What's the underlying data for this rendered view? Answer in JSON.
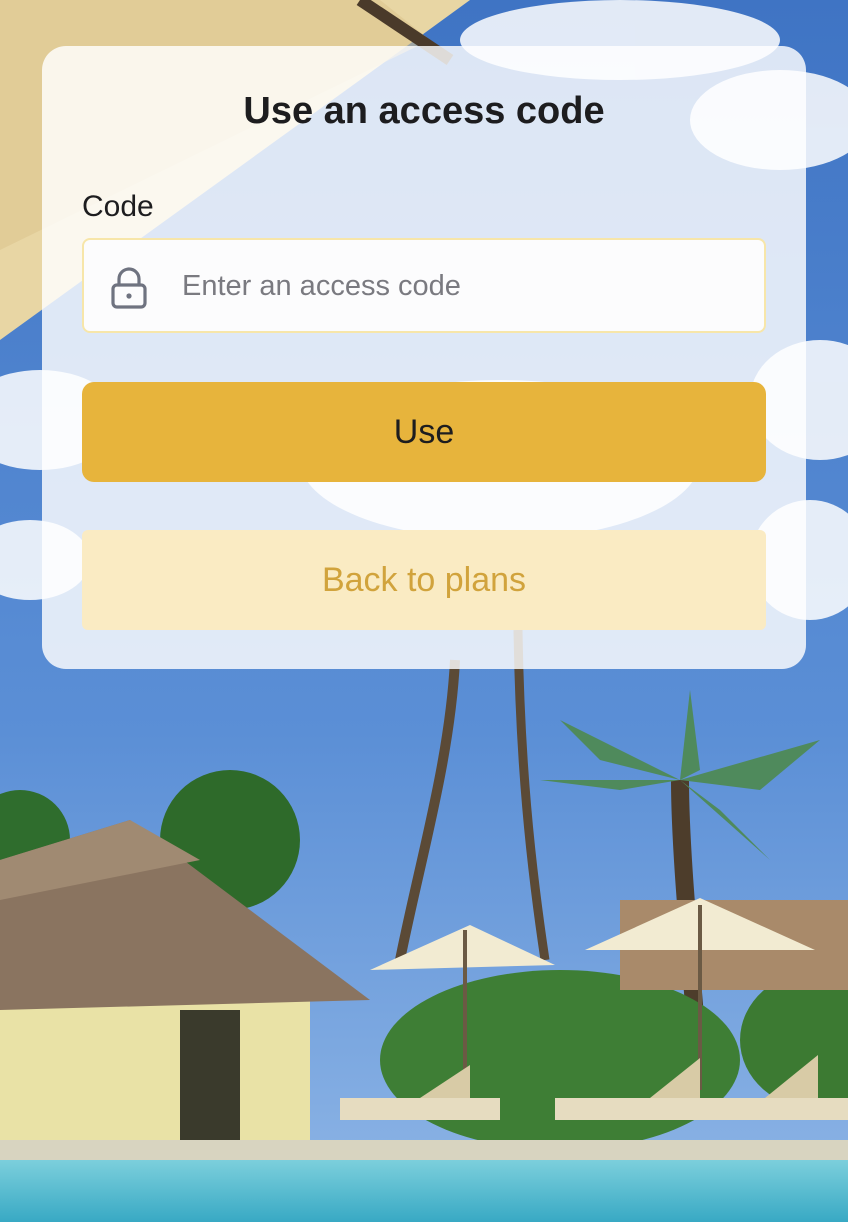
{
  "colors": {
    "accent": "#e7b43c",
    "secondary_bg": "#faebc3",
    "secondary_text": "#d1a33c",
    "field_border": "#f7e6a9"
  },
  "dialog": {
    "title": "Use an access code",
    "code_label": "Code",
    "code_placeholder": "Enter an access code",
    "code_value": "",
    "lock_icon": "lock-icon",
    "use_button": "Use",
    "back_button": "Back to plans"
  }
}
